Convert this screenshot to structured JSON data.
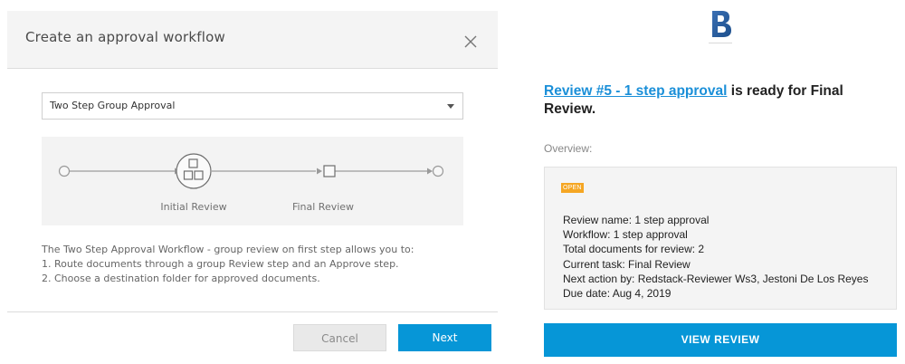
{
  "dialog": {
    "title": "Create an approval workflow",
    "workflow_select": {
      "selected": "Two Step Group Approval"
    },
    "diagram": {
      "steps": [
        "Initial Review",
        "Final Review"
      ]
    },
    "description": [
      "The Two Step Approval Workflow - group review on first step allows you to:",
      "1. Route documents through a group Review step and an Approve step.",
      "2. Choose a destination folder for approved documents."
    ],
    "buttons": {
      "cancel": "Cancel",
      "next": "Next"
    }
  },
  "email": {
    "logo_icon": "b-logo-icon",
    "headline_link": "Review #5 - 1 step approval",
    "headline_rest": " is ready for Final Review.",
    "overview_label": "Overview:",
    "status_badge": "OPEN",
    "details": [
      "Review name: 1 step approval",
      "Workflow: 1 step approval",
      "Total documents for review: 2",
      "Current task: Final Review",
      "Next action by: Redstack-Reviewer Ws3, Jestoni De Los Reyes",
      "Due date: Aug 4, 2019"
    ],
    "view_button": "VIEW REVIEW"
  },
  "colors": {
    "accent": "#0696d7",
    "link": "#1a8fd8",
    "badge": "#f5a623"
  }
}
